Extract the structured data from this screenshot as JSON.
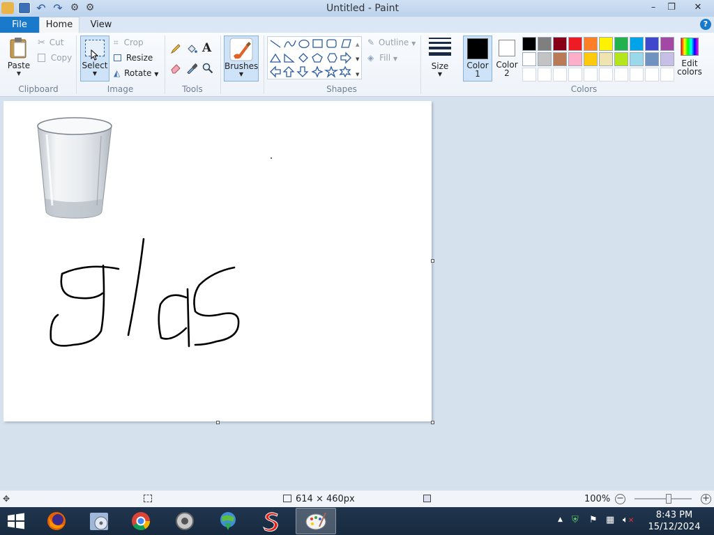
{
  "window": {
    "title": "Untitled - Paint",
    "minimize": "–",
    "maximize": "❐",
    "close": "✕"
  },
  "ribbon_tabs": {
    "file": "File",
    "home": "Home",
    "view": "View",
    "help": "?"
  },
  "clipboard": {
    "paste": "Paste",
    "cut": "Cut",
    "copy": "Copy",
    "group": "Clipboard"
  },
  "image": {
    "select": "Select",
    "crop": "Crop",
    "resize": "Resize",
    "rotate": "Rotate",
    "group": "Image"
  },
  "tools": {
    "text_glyph": "A",
    "group": "Tools"
  },
  "brushes": {
    "label": "Brushes"
  },
  "shapes": {
    "outline": "Outline",
    "fill": "Fill",
    "group": "Shapes"
  },
  "size": {
    "label": "Size"
  },
  "color1": {
    "label": "Color",
    "num": "1",
    "value": "#000000"
  },
  "color2": {
    "label": "Color",
    "num": "2",
    "value": "#ffffff"
  },
  "colors": {
    "group": "Colors",
    "edit_line1": "Edit",
    "edit_line2": "colors",
    "row1": [
      "#000000",
      "#7f7f7f",
      "#880015",
      "#ed1c24",
      "#ff7f27",
      "#fff200",
      "#22b14c",
      "#00a2e8",
      "#3f48cc",
      "#a349a4"
    ],
    "row2": [
      "#ffffff",
      "#c3c3c3",
      "#b97a57",
      "#ffaec9",
      "#ffc90e",
      "#efe4b0",
      "#b5e61d",
      "#99d9ea",
      "#7092be",
      "#c8bfe7"
    ]
  },
  "status": {
    "dimensions": "614 × 460px",
    "zoom": "100%",
    "zoom_fraction": 0.6
  },
  "taskbar": {
    "time": "8:43 PM",
    "date": "15/12/2024"
  }
}
